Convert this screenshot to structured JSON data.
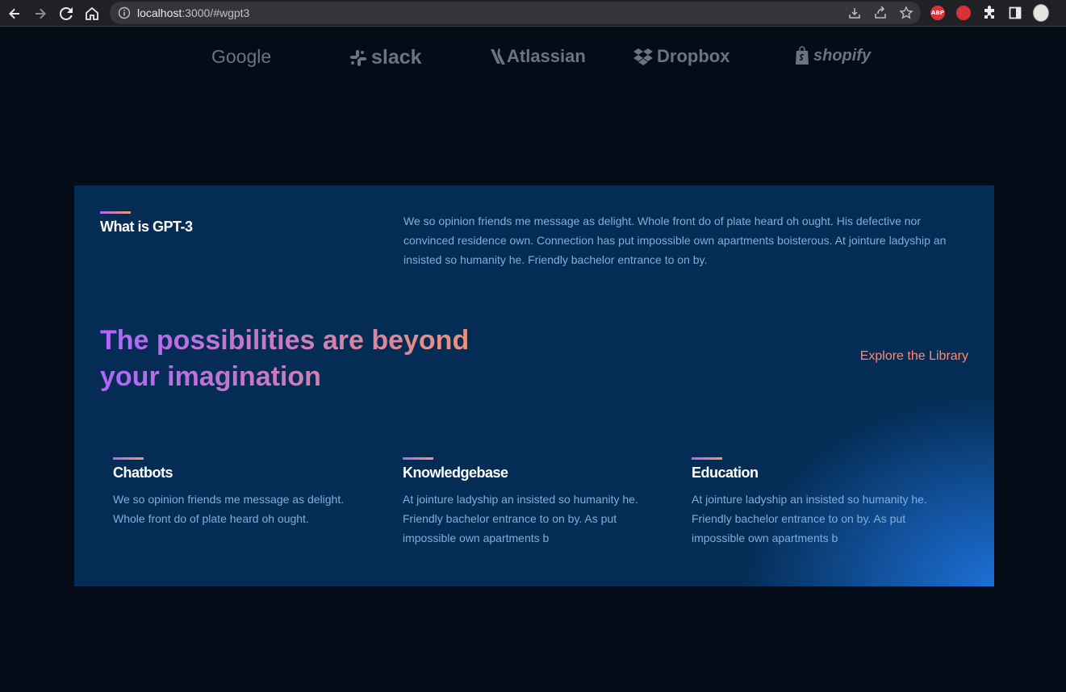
{
  "browser": {
    "url_host": "localhost",
    "url_rest": ":3000/#wgpt3",
    "extension_abp_label": "ABP"
  },
  "brands": [
    {
      "name": "Google",
      "icon": "google-wordmark"
    },
    {
      "name": "slack",
      "icon": "slack-logo-icon"
    },
    {
      "name": "Atlassian",
      "icon": "atlassian-logo-icon"
    },
    {
      "name": "Dropbox",
      "icon": "dropbox-logo-icon"
    },
    {
      "name": "shopify",
      "icon": "shopify-bag-icon"
    }
  ],
  "whatgpt3": {
    "title": "What is GPT-3",
    "description": "We so opinion friends me message as delight. Whole front do of plate heard oh ought. His defective nor convinced residence own. Connection has put impossible own apartments boisterous. At jointure ladyship an insisted so humanity he. Friendly bachelor entrance to on by.",
    "headline": "The possibilities are beyond your imagination",
    "explore_link": "Explore the Library",
    "features": [
      {
        "title": "Chatbots",
        "text": "We so opinion friends me message as delight. Whole front do of plate heard oh ought."
      },
      {
        "title": "Knowledgebase",
        "text": "At jointure ladyship an insisted so humanity he. Friendly bachelor entrance to on by. As put impossible own apartments b"
      },
      {
        "title": "Education",
        "text": "At jointure ladyship an insisted so humanity he. Friendly bachelor entrance to on by. As put impossible own apartments b"
      }
    ]
  },
  "colors": {
    "page_bg": "#040C18",
    "card_bg": "#042C54",
    "text_muted": "#81AFDD",
    "accent_link": "#FF8A71",
    "gradient_start": "#AE67FA",
    "gradient_end": "#F49867"
  }
}
